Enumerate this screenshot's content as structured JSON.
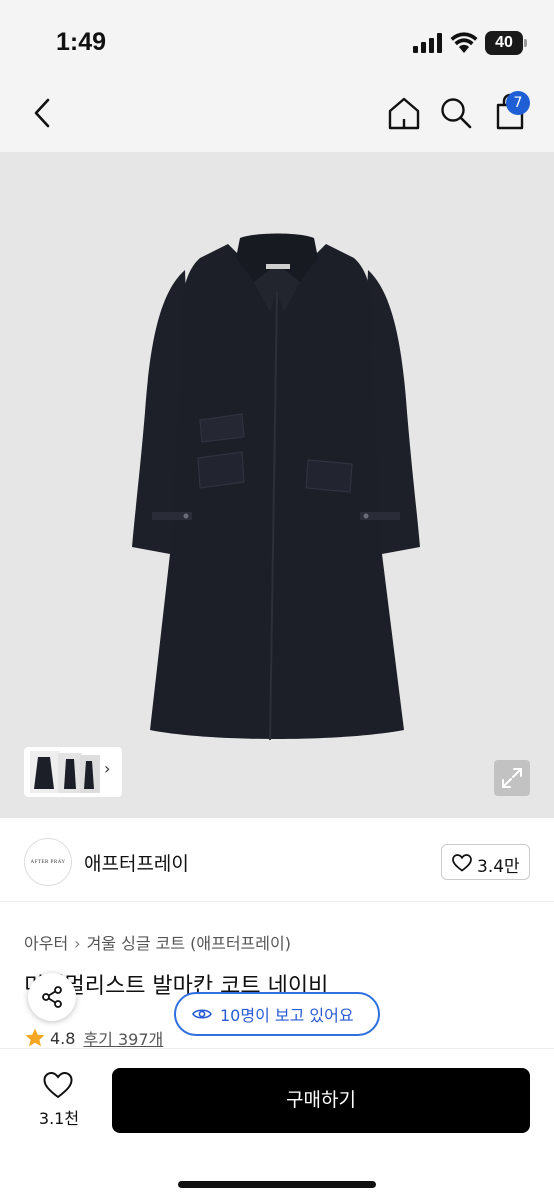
{
  "status_bar": {
    "time": "1:49",
    "battery": "40"
  },
  "nav": {
    "cart_count": "7"
  },
  "brand": {
    "logo_text": "AFTER PRAY",
    "name": "애프터프레이",
    "likes": "3.4만"
  },
  "breadcrumb": [
    "아우터",
    "겨울 싱글 코트 (애프터프레이)"
  ],
  "product": {
    "title": "미니멀리스트 발마칸 코트 네이비",
    "rating": "4.8",
    "reviews": "후기 397개"
  },
  "viewers_label": "10명이 보고 있어요",
  "bottom_bar": {
    "wish_count": "3.1천",
    "buy_label": "구매하기"
  },
  "colors": {
    "accent": "#2f6fe0",
    "badge": "#1f5fd6",
    "coat": "#1d1f28",
    "buy": "#000000"
  }
}
